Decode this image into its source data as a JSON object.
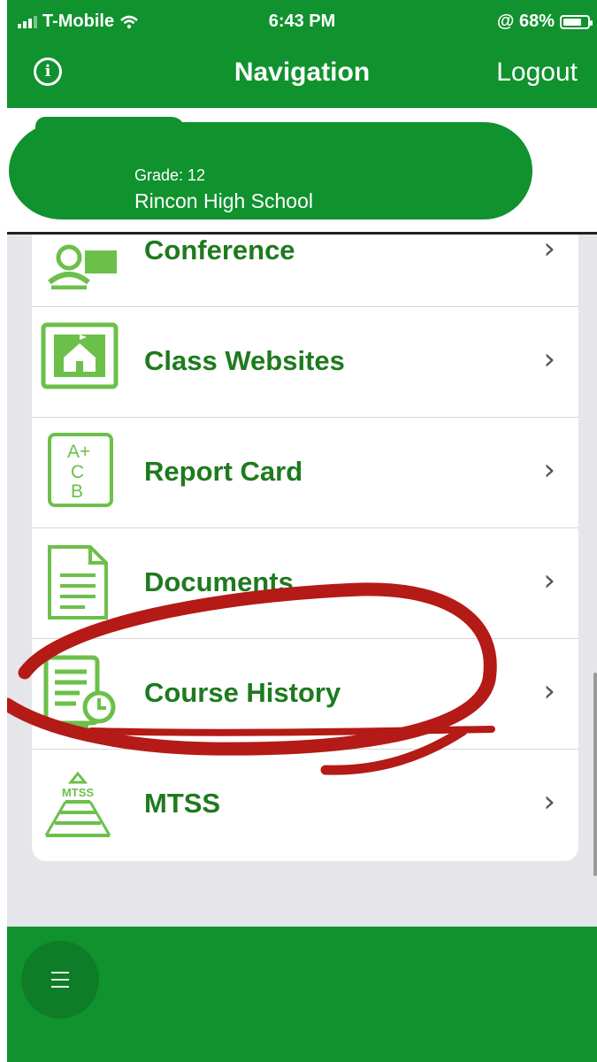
{
  "theme": {
    "green": "#10922e",
    "accent_text": "#1e7a1e",
    "annotation": "#b41a16"
  },
  "status_bar": {
    "carrier": "T-Mobile",
    "time": "6:43 PM",
    "battery": "@ 68%"
  },
  "nav_bar": {
    "info_glyph": "i",
    "title": "Navigation",
    "logout": "Logout"
  },
  "profile": {
    "grade": "Grade: 12",
    "school": "Rincon High School"
  },
  "menu": {
    "items": [
      {
        "label": "Conference",
        "icon": "conference-icon"
      },
      {
        "label": "Class Websites",
        "icon": "school-house-icon"
      },
      {
        "label": "Report Card",
        "icon": "report-card-icon"
      },
      {
        "label": "Documents",
        "icon": "document-icon"
      },
      {
        "label": "Course History",
        "icon": "course-history-icon"
      },
      {
        "label": "MTSS",
        "icon": "mtss-pyramid-icon"
      }
    ],
    "chevron": "›",
    "report_card_glyphs": {
      "a": "A+",
      "c": "C",
      "b": "B"
    },
    "mtss_glyph": "MTSS"
  },
  "bottom_bar": {
    "menu_icon": "hamburger-menu-icon"
  }
}
